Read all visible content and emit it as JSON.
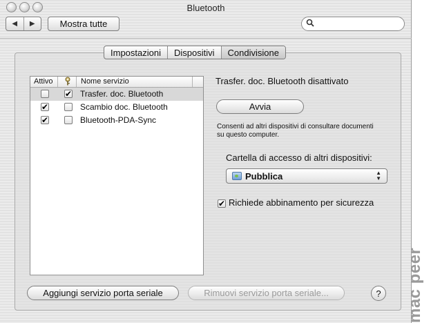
{
  "window": {
    "title": "Bluetooth"
  },
  "toolbar": {
    "back_icon": "◀",
    "forward_icon": "▶",
    "show_all_label": "Mostra tutte",
    "search_value": "",
    "search_icon": "magnifier"
  },
  "tabs": [
    {
      "label": "Impostazioni"
    },
    {
      "label": "Dispositivi"
    },
    {
      "label": "Condivisione"
    }
  ],
  "services_table": {
    "columns": {
      "active": "Attivo",
      "key": "",
      "name": "Nome servizio"
    },
    "rows": [
      {
        "name": "Trasfer. doc. Bluetooth",
        "active": false,
        "key": true,
        "selected": true
      },
      {
        "name": "Scambio doc. Bluetooth",
        "active": true,
        "key": false,
        "selected": false
      },
      {
        "name": "Bluetooth-PDA-Sync",
        "active": true,
        "key": false,
        "selected": false
      }
    ]
  },
  "detail": {
    "status": "Trasfer. doc. Bluetooth disattivato",
    "start_button": "Avvia",
    "description": "Consenti ad altri dispositivi di consultare documenti su questo computer.",
    "folder_label": "Cartella di accesso di altri dispositivi:",
    "folder_value": "Pubblica",
    "pairing_label": "Richiede abbinamento per sicurezza",
    "pairing_checked": true
  },
  "bottom": {
    "add_button": "Aggiungi servizio porta seriale",
    "remove_button": "Rimuovi servizio porta seriale...",
    "help_label": "?"
  },
  "watermark": "mac peer"
}
